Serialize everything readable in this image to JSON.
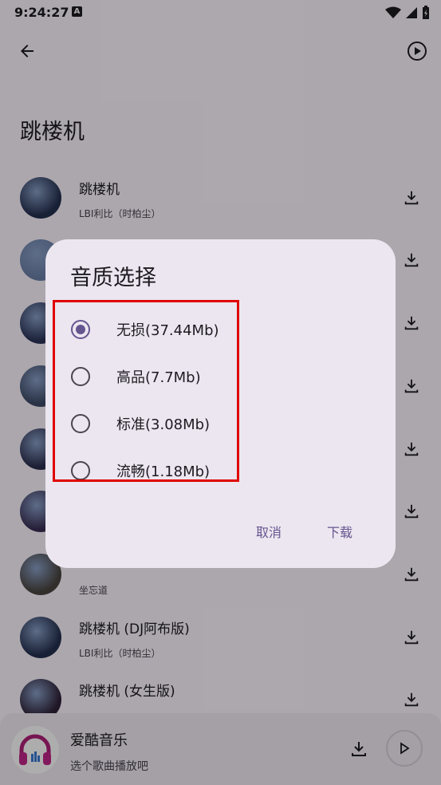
{
  "status": {
    "time": "9:24:27",
    "badge": "A"
  },
  "page": {
    "title": "跳楼机"
  },
  "songs": [
    {
      "title": "跳楼机",
      "artist": "LBI利比（时柏尘）",
      "cover": "#24304f"
    },
    {
      "title": "",
      "artist": "",
      "cover": "#6a7fa8"
    },
    {
      "title": "",
      "artist": "",
      "cover": "#2a3357"
    },
    {
      "title": "",
      "artist": "",
      "cover": "#3d4a66"
    },
    {
      "title": "",
      "artist": "",
      "cover": "#2b2f4f"
    },
    {
      "title": "",
      "artist": "",
      "cover": "#3a2f55"
    },
    {
      "title": "",
      "artist": "坐忘道",
      "cover": "#4a4540"
    },
    {
      "title": "跳楼机 (DJ阿布版)",
      "artist": "LBI利比（时柏尘）",
      "cover": "#24304f"
    },
    {
      "title": "跳楼机 (女生版)",
      "artist": "",
      "cover": "#2e2238"
    }
  ],
  "player": {
    "title": "爱酷音乐",
    "subtitle": "选个歌曲播放吧"
  },
  "dialog": {
    "title": "音质选择",
    "options": [
      {
        "label": "无损(37.44Mb)",
        "selected": true
      },
      {
        "label": "高品(7.7Mb)",
        "selected": false
      },
      {
        "label": "标准(3.08Mb)",
        "selected": false
      },
      {
        "label": "流畅(1.18Mb)",
        "selected": false
      }
    ],
    "cancel": "取消",
    "confirm": "下载"
  },
  "colors": {
    "accent": "#65558f",
    "highlight": "#e00000"
  }
}
